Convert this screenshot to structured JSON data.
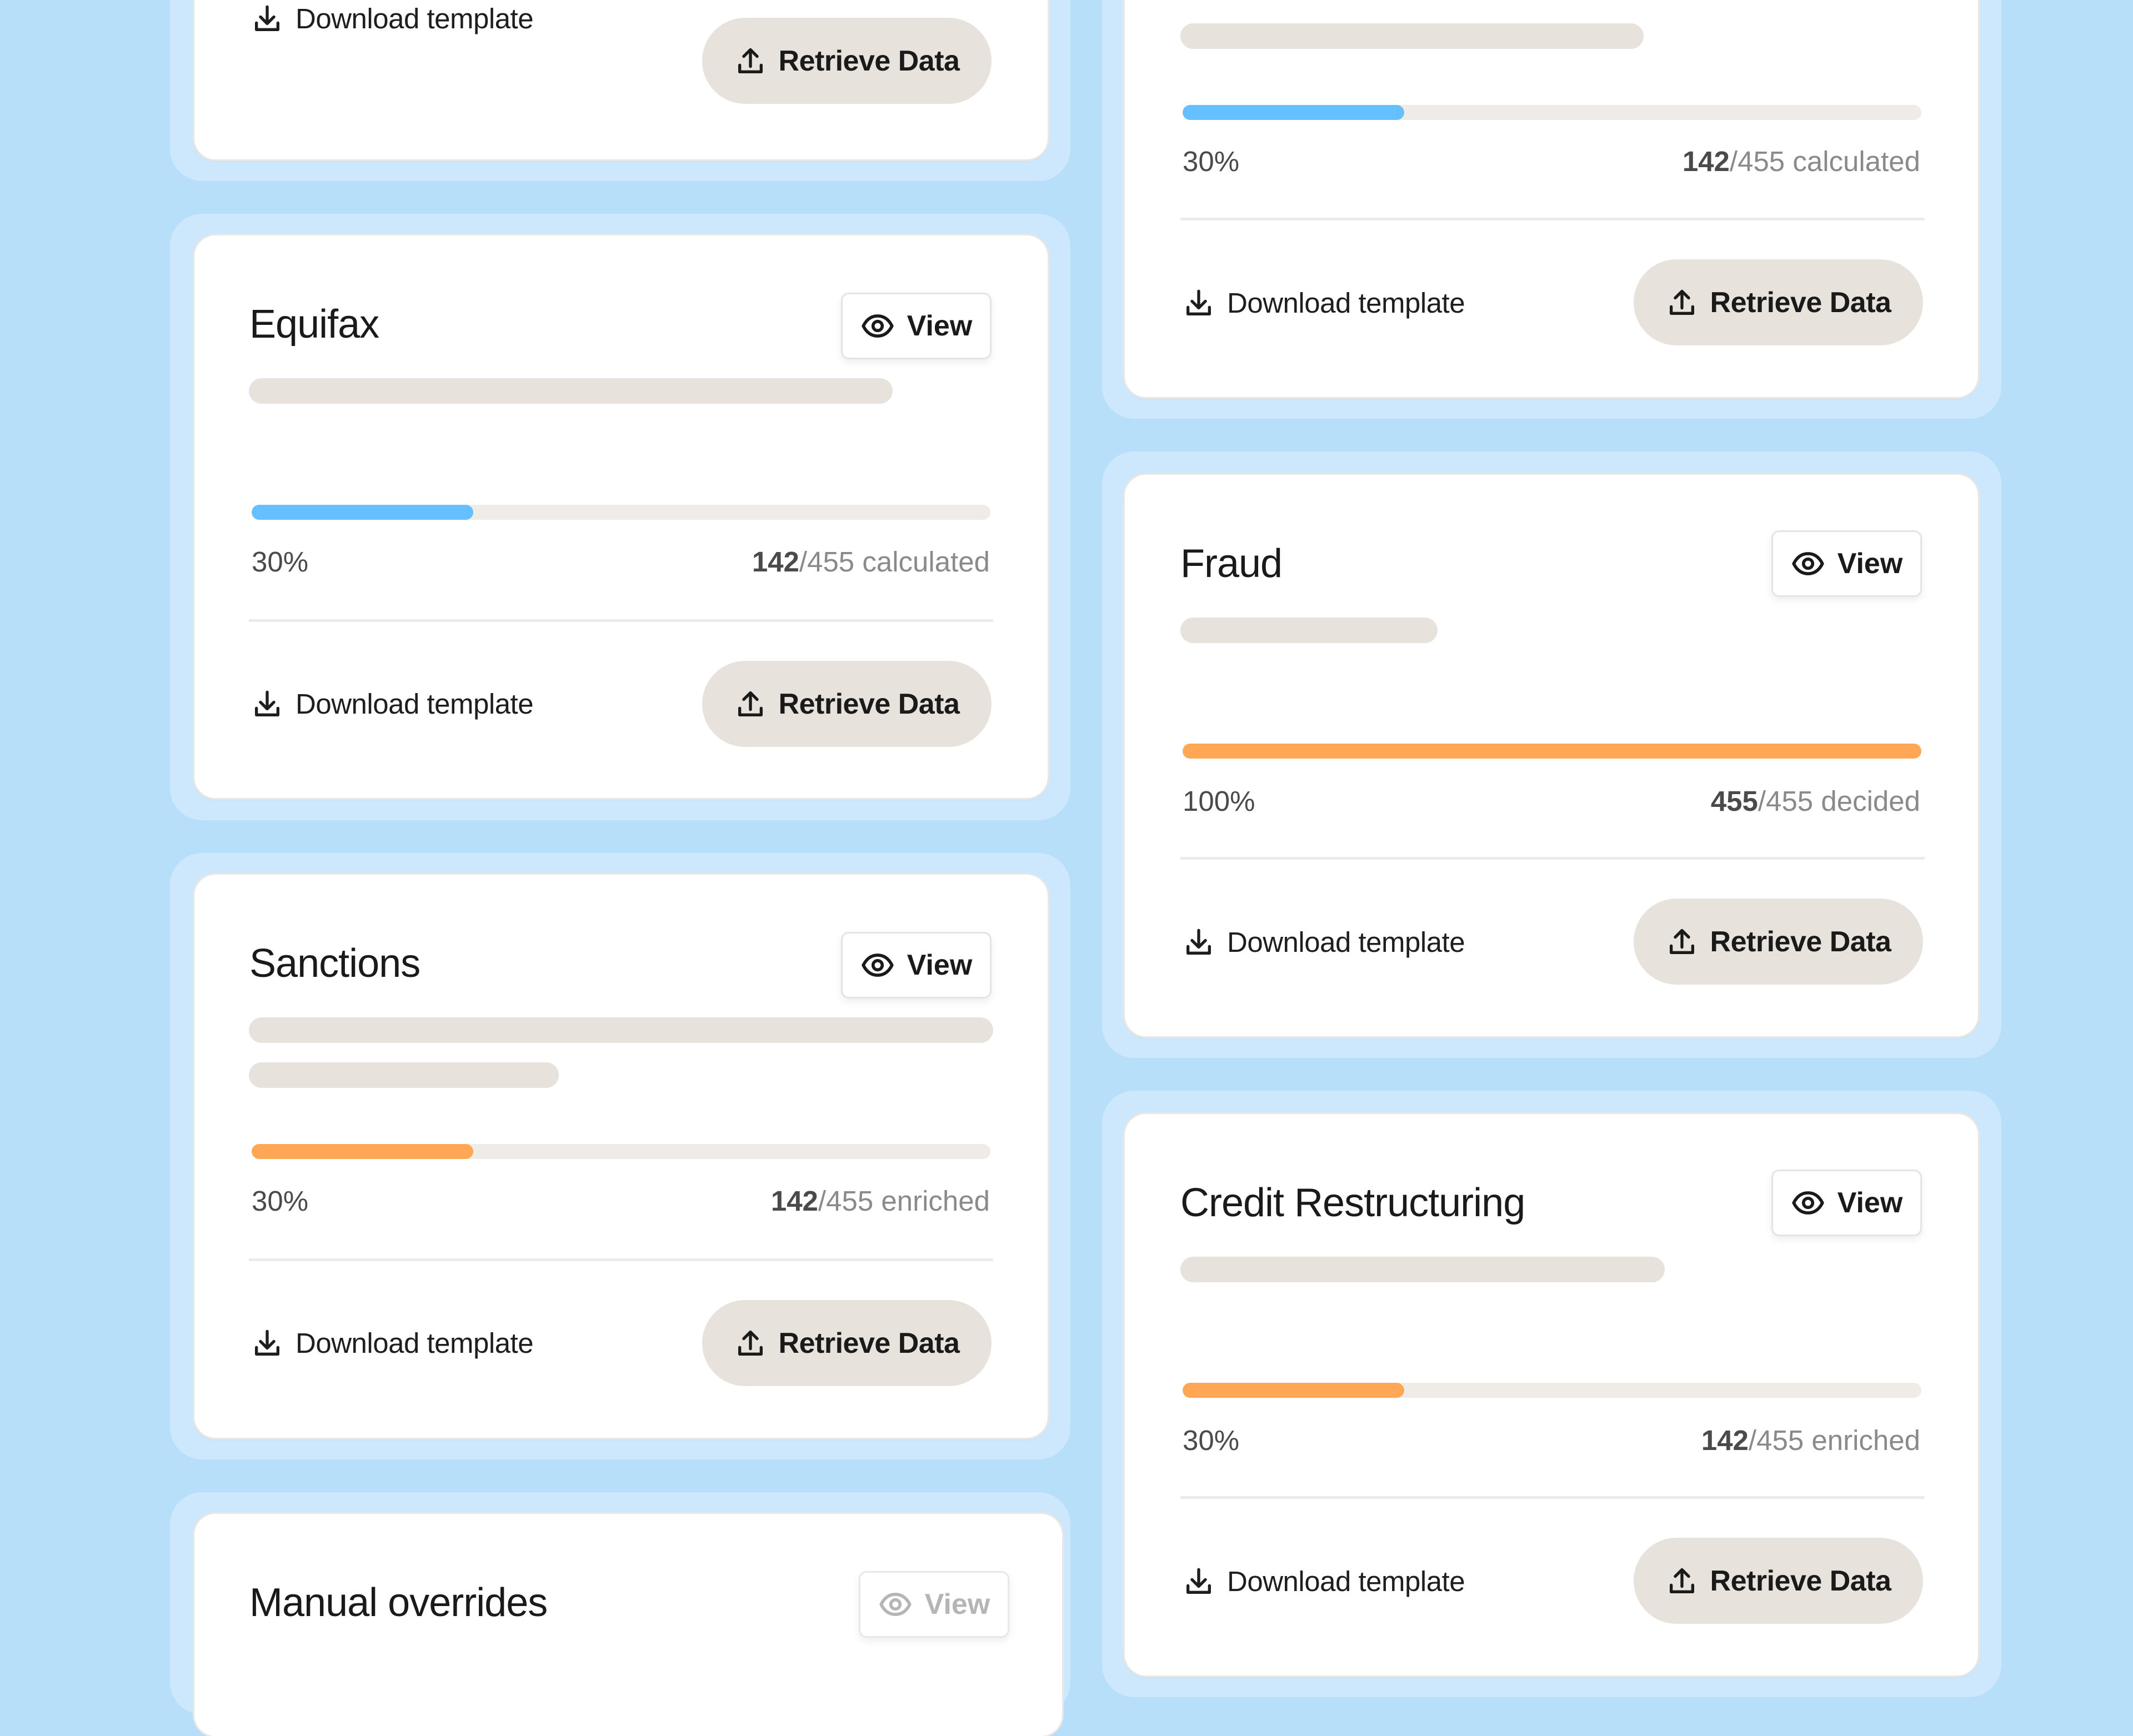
{
  "colors": {
    "background": "#B8DFFA",
    "card_wrapper": "#CDE8FC",
    "card": "#FFFFFF",
    "skeleton": "#E8E2DD",
    "track": "#EFEBE7",
    "progress_blue": "#66BFFF",
    "progress_orange": "#FFA755",
    "retrieve_button": "#E8E2DD"
  },
  "labels": {
    "view": "View",
    "download_template": "Download template",
    "retrieve_data": "Retrieve Data"
  },
  "icons": {
    "view": "eye-icon",
    "download": "download-icon",
    "retrieve": "upload-icon"
  },
  "cards": [
    {
      "id": "left-top",
      "title": null,
      "footer_only": true
    },
    {
      "id": "equifax",
      "title": "Equifax",
      "progress": {
        "percent_label": "30%",
        "fraction": 0.3,
        "color": "blue",
        "done": "142",
        "total": "/455",
        "unit": " calculated"
      }
    },
    {
      "id": "sanctions",
      "title": "Sanctions",
      "progress": {
        "percent_label": "30%",
        "fraction": 0.3,
        "color": "orange",
        "done": "142",
        "total": "/455",
        "unit": " enriched"
      }
    },
    {
      "id": "manual-overrides",
      "title": "Manual overrides",
      "view_disabled": true
    },
    {
      "id": "right-top",
      "title": null,
      "progress": {
        "percent_label": "30%",
        "fraction": 0.3,
        "color": "blue",
        "done": "142",
        "total": "/455",
        "unit": " calculated"
      }
    },
    {
      "id": "fraud",
      "title": "Fraud",
      "progress": {
        "percent_label": "100%",
        "fraction": 1.0,
        "color": "orange",
        "done": "455",
        "total": "/455",
        "unit": " decided"
      }
    },
    {
      "id": "credit-restructuring",
      "title": "Credit Restructuring",
      "progress": {
        "percent_label": "30%",
        "fraction": 0.3,
        "color": "orange",
        "done": "142",
        "total": "/455",
        "unit": " enriched"
      }
    }
  ]
}
